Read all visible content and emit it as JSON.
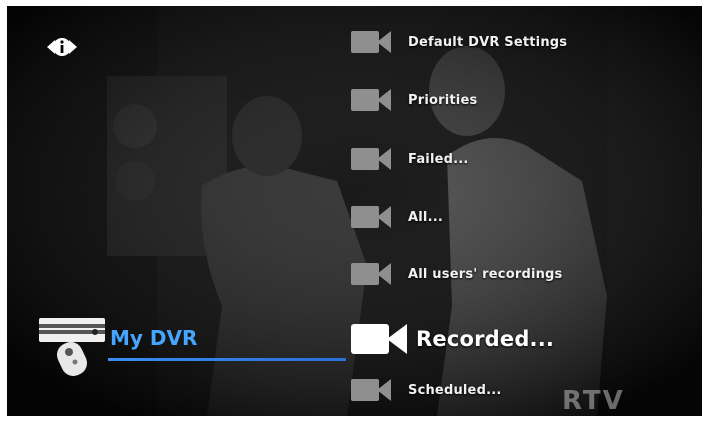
{
  "menu": {
    "items": [
      {
        "label": "Default DVR Settings",
        "selected": false
      },
      {
        "label": "Priorities",
        "selected": false
      },
      {
        "label": "Failed...",
        "selected": false
      },
      {
        "label": "All...",
        "selected": false
      },
      {
        "label": "All users' recordings",
        "selected": false
      },
      {
        "label": "Recorded...",
        "selected": true
      },
      {
        "label": "Scheduled...",
        "selected": false
      }
    ]
  },
  "section": {
    "title": "My DVR"
  },
  "watermark": {
    "text": "RTV"
  },
  "icons": {
    "info": "info-icon",
    "menu_item": "video-camera-icon",
    "section": "dvr-remote-icon"
  },
  "colors": {
    "accent": "#46a6ff",
    "underline": "#3a8df0",
    "background": "#050505",
    "text": "#f2f2f2"
  }
}
